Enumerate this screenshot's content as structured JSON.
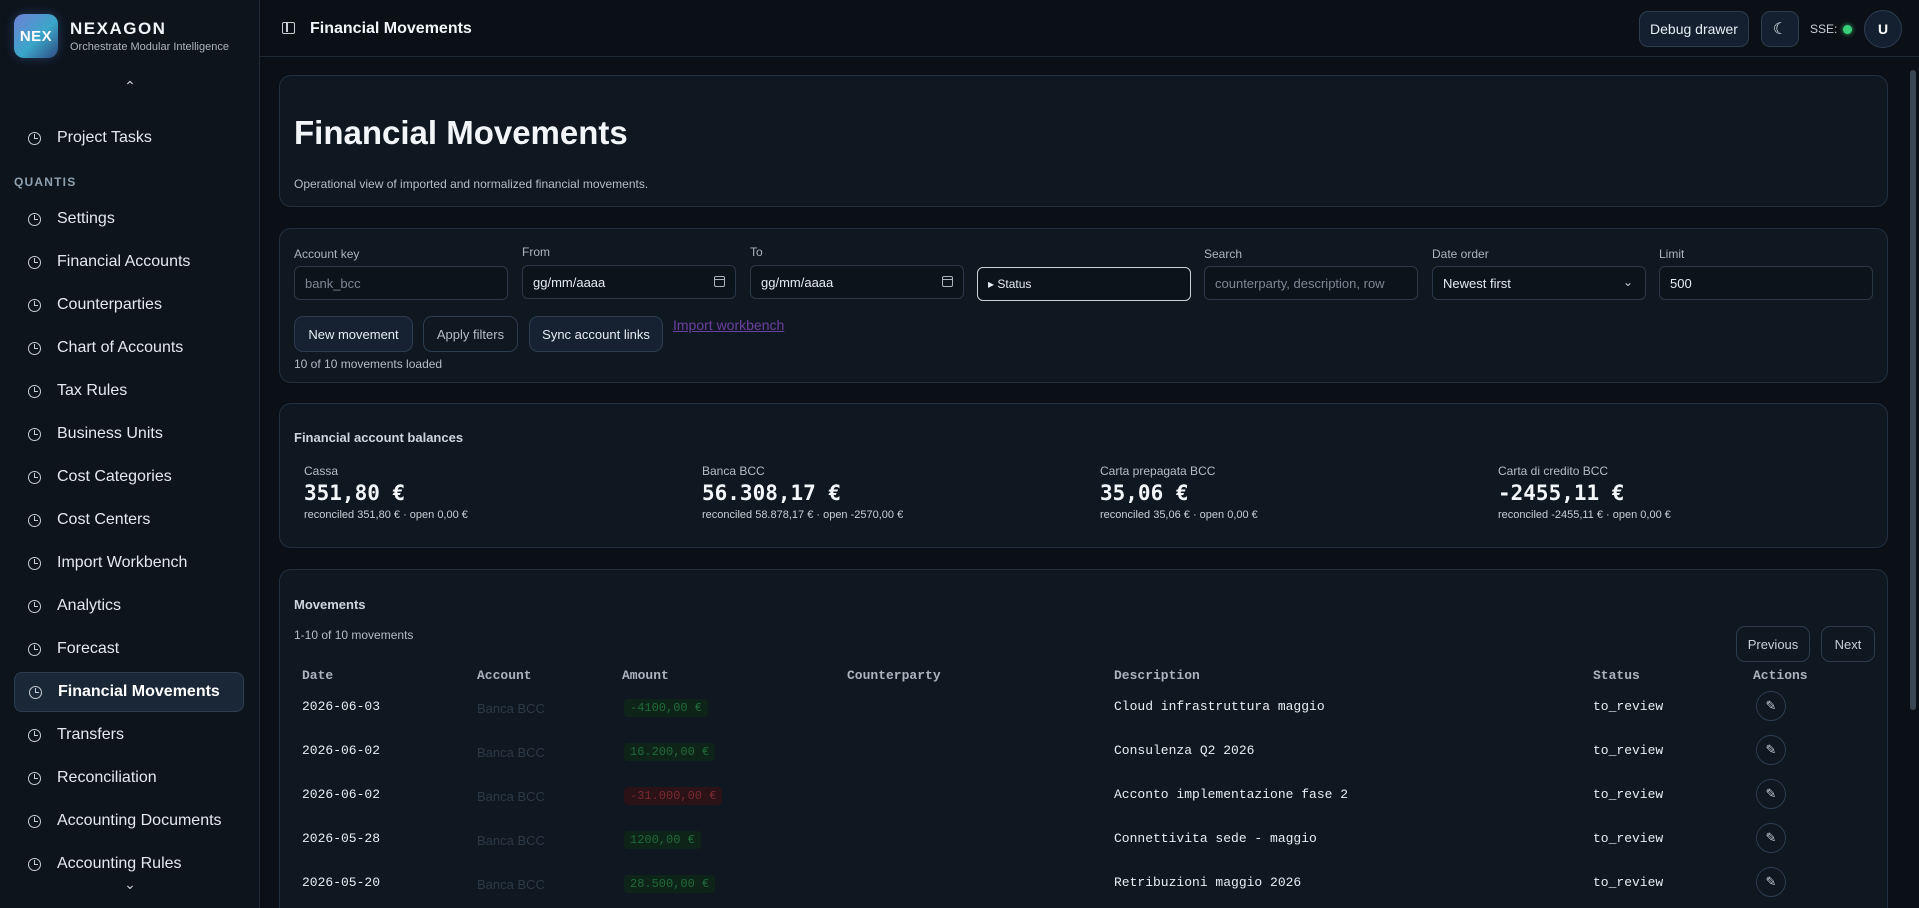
{
  "brand": {
    "logo": "NEX",
    "name": "NEXAGON",
    "tagline": "Orchestrate Modular Intelligence"
  },
  "sidebar": {
    "top_item": "Project Tasks",
    "section": "QUANTIS",
    "items": [
      "Settings",
      "Financial Accounts",
      "Counterparties",
      "Chart of Accounts",
      "Tax Rules",
      "Business Units",
      "Cost Categories",
      "Cost Centers",
      "Import Workbench",
      "Analytics",
      "Forecast",
      "Financial Movements",
      "Transfers",
      "Reconciliation",
      "Accounting Documents",
      "Accounting Rules"
    ],
    "active": "Financial Movements"
  },
  "header": {
    "title": "Financial Movements",
    "debug_label": "Debug drawer",
    "sse_label": "SSE:",
    "avatar": "U"
  },
  "page": {
    "title": "Financial Movements",
    "subtitle": "Operational view of imported and normalized financial movements."
  },
  "filters": {
    "account_key_label": "Account key",
    "account_key_placeholder": "bank_bcc",
    "from_label": "From",
    "from_value": "gg/mm/aaaa",
    "to_label": "To",
    "to_value": "gg/mm/aaaa",
    "status_label": "▸ Status",
    "search_label": "Search",
    "search_placeholder": "counterparty, description, row",
    "date_order_label": "Date order",
    "date_order_value": "Newest first",
    "limit_label": "Limit",
    "limit_value": "500",
    "new_movement": "New movement",
    "apply_filters": "Apply filters",
    "sync_links": "Sync account links",
    "import_link": "Import workbench",
    "loaded": "10 of 10 movements loaded"
  },
  "balances": {
    "title": "Financial account balances",
    "accounts": [
      {
        "name": "Cassa",
        "value": "351,80 €",
        "detail": "reconciled 351,80 € · open 0,00 €"
      },
      {
        "name": "Banca BCC",
        "value": "56.308,17 €",
        "detail": "reconciled 58.878,17 € · open -2570,00 €"
      },
      {
        "name": "Carta prepagata BCC",
        "value": "35,06 €",
        "detail": "reconciled 35,06 € · open 0,00 €"
      },
      {
        "name": "Carta di credito BCC",
        "value": "-2455,11 €",
        "detail": "reconciled -2455,11 € · open 0,00 €"
      }
    ]
  },
  "movements": {
    "title": "Movements",
    "count": "1-10 of 10 movements",
    "prev": "Previous",
    "next": "Next",
    "columns": [
      "Date",
      "Account",
      "Amount",
      "Counterparty",
      "Description",
      "Status",
      "Actions"
    ],
    "rows": [
      {
        "date": "2026-06-03",
        "account": "Banca BCC",
        "amount": "-4100,00 €",
        "sign": "pos",
        "description": "Cloud infrastruttura maggio",
        "status": "to_review"
      },
      {
        "date": "2026-06-02",
        "account": "Banca BCC",
        "amount": "16.200,00 €",
        "sign": "pos",
        "description": "Consulenza Q2 2026",
        "status": "to_review"
      },
      {
        "date": "2026-06-02",
        "account": "Banca BCC",
        "amount": "-31.000,00 €",
        "sign": "neg",
        "description": "Acconto implementazione fase 2",
        "status": "to_review"
      },
      {
        "date": "2026-05-28",
        "account": "Banca BCC",
        "amount": "1200,00 €",
        "sign": "pos",
        "description": "Connettivita sede - maggio",
        "status": "to_review"
      },
      {
        "date": "2026-05-20",
        "account": "Banca BCC",
        "amount": "28.500,00 €",
        "sign": "pos",
        "description": "Retribuzioni maggio 2026",
        "status": "to_review"
      }
    ]
  },
  "colors": {
    "accent_green": "#3ad07a",
    "link": "#6b3fa0",
    "bg": "#0b1016"
  }
}
